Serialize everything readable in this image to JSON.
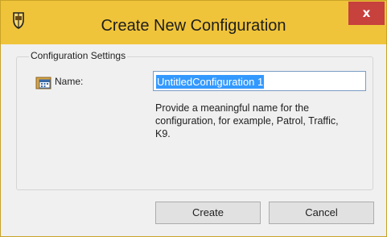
{
  "window": {
    "title": "Create New Configuration",
    "close_label": "x"
  },
  "group": {
    "legend": "Configuration Settings",
    "name_label": "Name:",
    "name_value": "UntitledConfiguration 1",
    "help_text": "Provide a meaningful name for the configuration, for example, Patrol, Traffic, K9."
  },
  "buttons": {
    "create": "Create",
    "cancel": "Cancel"
  },
  "icons": {
    "app": "shield-icon",
    "name": "calendar-folder-icon"
  },
  "colors": {
    "titlebar": "#f0c43a",
    "close": "#c7413d",
    "selection": "#3399ff"
  }
}
